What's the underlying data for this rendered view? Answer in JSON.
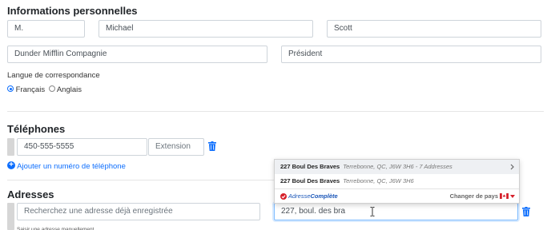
{
  "personal": {
    "title": "Informations personnelles",
    "salutation": "M.",
    "first_name": "Michael",
    "last_name": "Scott",
    "company": "Dunder Mifflin Compagnie",
    "job_title": "Président",
    "language_label": "Langue de correspondance",
    "language_options": [
      "Français",
      "Anglais"
    ],
    "language_selected": "Français"
  },
  "phones": {
    "title": "Téléphones",
    "number": "450-555-5555",
    "extension_placeholder": "Extension",
    "add_link": "Ajouter un numéro de téléphone"
  },
  "addresses": {
    "title": "Adresses",
    "saved_search_placeholder": "Recherchez une adresse déjà enregistrée",
    "address_input": "227, boul. des bra",
    "manual_link": "Saisir une adresse manuellement"
  },
  "autocomplete": {
    "results": [
      {
        "street": "227 Boul Des Braves",
        "detail": "Terrebonne, QC, J6W 3H6 - 7 Addresses",
        "has_children": true
      },
      {
        "street": "227 Boul Des Braves",
        "detail": "Terrebonne, QC, J6W 3H6",
        "has_children": false
      }
    ],
    "brand_prefix": "Adresse",
    "brand_suffix": "Complète",
    "change_country": "Changer de pays",
    "country_flag": "canada-flag"
  },
  "colors": {
    "accent": "#0d6efd",
    "trash": "#0d6efd",
    "brand_red": "#d6202b"
  }
}
